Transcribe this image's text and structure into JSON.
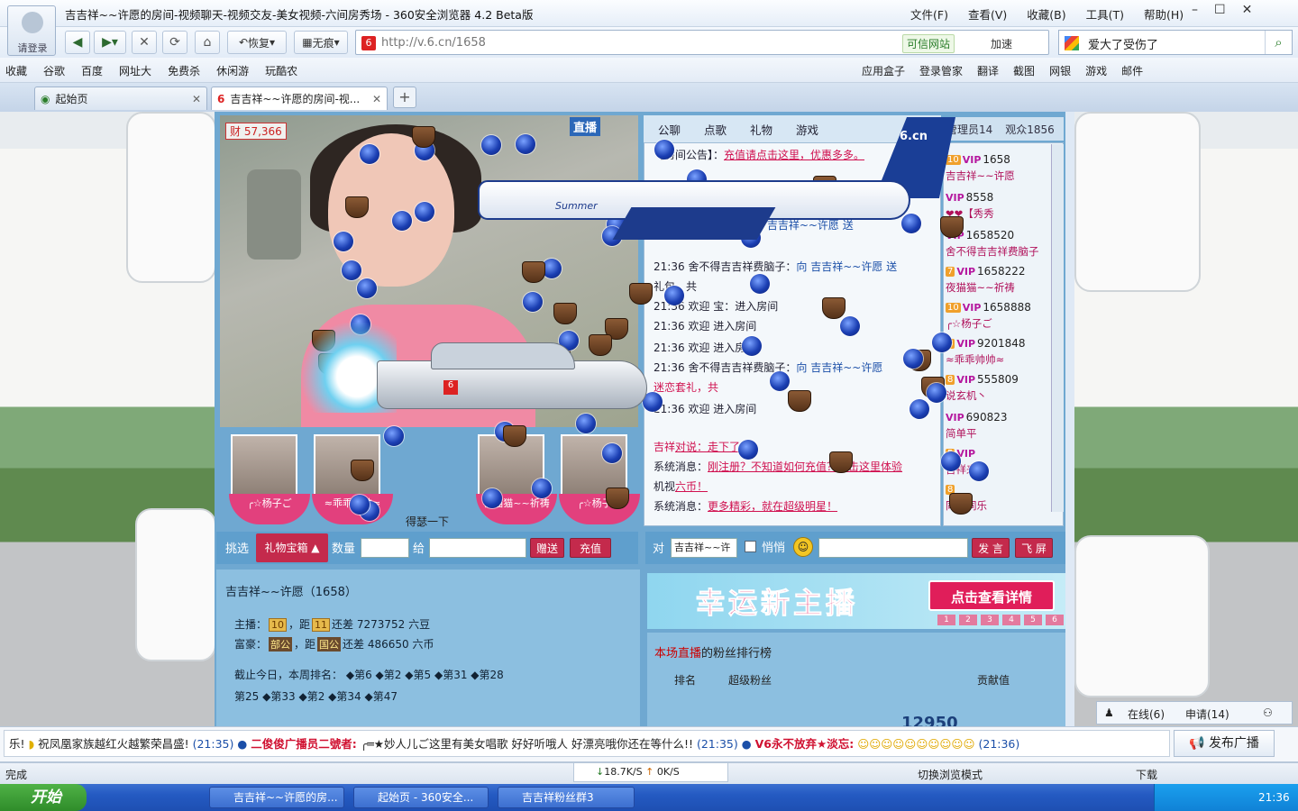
{
  "window": {
    "title": "吉吉祥~~许愿的房间-视频聊天-视频交友-美女视频-六间房秀场 - 360安全浏览器 4.2 Beta版",
    "login_label": "请登录",
    "menus": [
      "文件(F)",
      "查看(V)",
      "收藏(B)",
      "工具(T)",
      "帮助(H)"
    ]
  },
  "toolbar": {
    "restore_label": "恢复",
    "notrace_label": "无痕",
    "url": "http://v.6.cn/1658",
    "trusted_label": "可信网站",
    "speedup_label": "加速",
    "search_query": "爱大了受伤了"
  },
  "favbar": {
    "left": [
      "收藏",
      "谷歌",
      "百度",
      "网址大",
      "免费杀",
      "休闲游",
      "玩酷农"
    ],
    "right": [
      "应用盒子",
      "登录管家",
      "翻译",
      "截图",
      "网银",
      "游戏",
      "邮件"
    ]
  },
  "tabs": [
    {
      "label": "起始页"
    },
    {
      "label": "吉吉祥~~许愿的房间-视..."
    }
  ],
  "video": {
    "cai_count": "57,366",
    "live_label": "直播",
    "favicon": "6"
  },
  "plane": {
    "label": "Summer",
    "logo": "6.cn"
  },
  "fans": {
    "labels": [
      "╭☆杨子ご",
      "≈乖乖帅帅≈",
      "",
      "夜猫猫~~祈祷",
      "╭☆杨子ご"
    ],
    "tip": "得瑟一下"
  },
  "gift": {
    "pick_label": "挑选",
    "box_label": "礼物宝箱",
    "qty_label": "数量",
    "to_label": "给",
    "send_label": "赠送",
    "charge_label": "充值"
  },
  "room": {
    "title": "吉吉祥~~许愿（1658）",
    "host_row": {
      "label": "主播：",
      "lvl1": "10",
      "dist": "，距",
      "lvl2": "11",
      "diff": "还差 7273752 六豆"
    },
    "rich_row": {
      "label": "富豪：",
      "b1": "部公",
      "dist": "，距",
      "b2": "国公",
      "diff": "还差 486650 六币"
    },
    "rank_row1": "截止今日，本周排名：",
    "ranks": [
      "第6",
      "第2",
      "第5",
      "第31",
      "第28",
      "第25",
      "第33",
      "第2",
      "第34",
      "第47"
    ]
  },
  "chat": {
    "tabs": [
      "公聊",
      "点歌",
      "礼物",
      "游戏"
    ],
    "messages": [
      {
        "pre": "【房间公告】：",
        "txt": "充值请点击这里，优惠多多。"
      },
      {
        "pre": "",
        "txt": "向 吉吉祥~~许愿 送"
      },
      {
        "pre": "21:36 舍不得吉吉祥费脑子：",
        "txt": "向 吉吉祥~~许愿 送"
      },
      {
        "pre": "礼包，共",
        "txt": ""
      },
      {
        "pre": "21:36 欢迎",
        "txt": "宝：进入房间"
      },
      {
        "pre": "21:36 欢迎",
        "txt": "进入房间"
      },
      {
        "pre": "21:36 欢迎",
        "txt": "进入房间"
      },
      {
        "pre": "21:36 舍不得吉吉祥费脑子：",
        "txt": "向 吉吉祥~~许愿"
      },
      {
        "pre": "迷恋套礼，共",
        "txt": ""
      },
      {
        "pre": "21:36 欢迎",
        "txt": "进入房间"
      },
      {
        "pre": "吉祥",
        "txt": "对说：走下了"
      },
      {
        "pre": "系统消息：",
        "txt": "刚注册？不知道如何充值？点击这里体验"
      },
      {
        "pre": "机视",
        "txt": "六币！"
      },
      {
        "pre": "系统消息：",
        "txt": "更多精彩，就在超级明星！"
      }
    ],
    "to_label": "对",
    "to_value": "吉吉祥~~许",
    "private_label": "悄悄",
    "say_label": "发 言",
    "fly_label": "飞 屏"
  },
  "users": {
    "admin_tab": "管理员14",
    "audience_tab": "观众1856",
    "list": [
      {
        "lvl": "10",
        "id": "1658",
        "name": "吉吉祥~~许愿"
      },
      {
        "lvl": "",
        "id": "8558",
        "name": "❤❤【秀秀"
      },
      {
        "lvl": "",
        "id": "1658520",
        "name": "舍不得吉吉祥费脑子"
      },
      {
        "lvl": "7",
        "id": "1658222",
        "name": "夜猫猫~~祈祷"
      },
      {
        "lvl": "10",
        "id": "1658888",
        "name": "╭☆杨子ご"
      },
      {
        "lvl": "8",
        "id": "9201848",
        "name": "≈乖乖帅帅≈"
      },
      {
        "lvl": "8",
        "id": "555809",
        "name": "说玄机丶"
      },
      {
        "lvl": "",
        "id": "690823",
        "name": "简单平"
      },
      {
        "lvl": "5",
        "id": "",
        "name": "吉祥来了"
      },
      {
        "lvl": "8",
        "id": "",
        "name": "同心同乐"
      }
    ]
  },
  "banner": {
    "title": "幸运新主播",
    "button": "点击查看详情",
    "pages": [
      "1",
      "2",
      "3",
      "4",
      "5",
      "6"
    ]
  },
  "fans_rank": {
    "title_red": "本场直播",
    "title_rest": "的粉丝排行榜",
    "cols": [
      "排名",
      "超级粉丝",
      "贡献值"
    ],
    "value": "12950"
  },
  "online": {
    "online_label": "在线(6)",
    "apply_label": "申请(14)"
  },
  "ticker": {
    "items": [
      {
        "pre": "乐!",
        "txt": "祝凤凰家族越红火越繁荣昌盛!",
        "time": "(21:35)"
      },
      {
        "pre": "二俊俊广播员二號者:",
        "txt": "╭═★妙人儿ご这里有美女唱歌 好好听哦人 好漂亮哦你还在等什么!!",
        "time": "(21:35)"
      },
      {
        "pre": "V6永不放弃★淡忘:",
        "txt": "",
        "time": "(21:36)"
      }
    ],
    "publish_label": "发布广播"
  },
  "status": {
    "left": "完成",
    "down": "18.7K/S",
    "up": "0K/S",
    "mode": "切换浏览模式",
    "download": "下载"
  },
  "taskbar": {
    "start": "开始",
    "tasks": [
      "吉吉祥~~许愿的房...",
      "起始页 - 360安全...",
      "吉吉祥粉丝群3"
    ],
    "clock": "21:36"
  }
}
